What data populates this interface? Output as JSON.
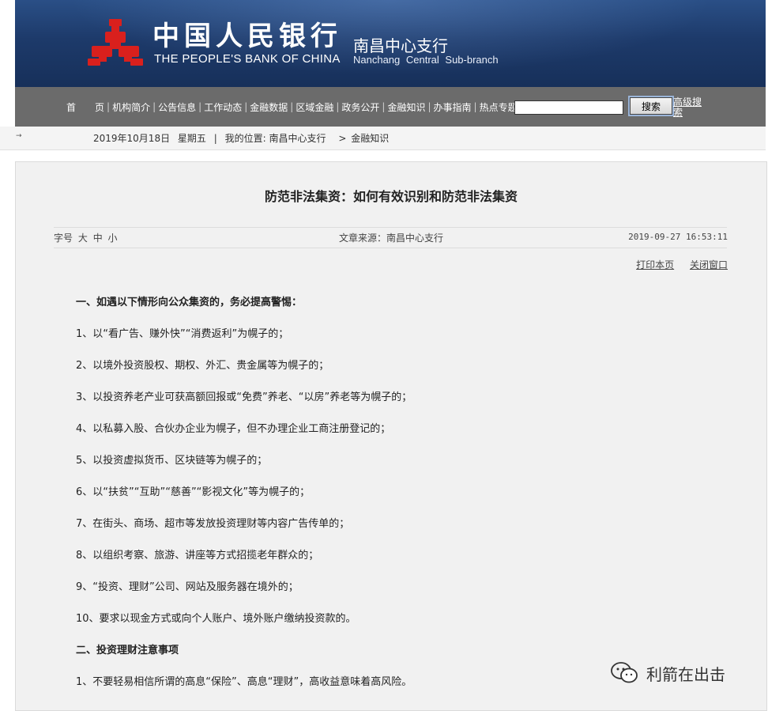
{
  "header": {
    "bank_name_cn": "中国人民银行",
    "bank_name_en": "THE PEOPLE'S BANK OF CHINA",
    "branch_cn": "南昌中心支行",
    "branch_en": "Nanchang Central Sub-branch",
    "logo_icon": "pboc-logo-icon",
    "logo_color": "#d9201d"
  },
  "nav": {
    "items": [
      "首　　页",
      "机构简介",
      "公告信息",
      "工作动态",
      "金融数据",
      "区域金融",
      "政务公开",
      "金融知识",
      "办事指南",
      "热点专题"
    ],
    "separator": "|",
    "search_value": "",
    "search_button": "搜索",
    "advanced_search": "高级搜索"
  },
  "breadcrumb": {
    "date": "2019年10月18日",
    "weekday": "星期五",
    "separator": "|",
    "location_label": "我的位置:",
    "location_root": "南昌中心支行",
    "arrow": ">",
    "current": "金融知识"
  },
  "article": {
    "title": "防范非法集资：如何有效识别和防范非法集资",
    "font_size_label": "字号",
    "font_sizes": [
      "大",
      "中",
      "小"
    ],
    "source": "文章来源：南昌中心支行",
    "datetime": "2019-09-27 16:53:11",
    "print": "打印本页",
    "close": "关闭窗口",
    "paragraphs": [
      {
        "text": "一、如遇以下情形向公众集资的，务必提高警惕：",
        "heading": true
      },
      {
        "text": "1、以“看广告、赚外快”“消费返利”为幌子的；",
        "heading": false
      },
      {
        "text": "2、以境外投资股权、期权、外汇、贵金属等为幌子的；",
        "heading": false
      },
      {
        "text": "3、以投资养老产业可获高额回报或“免费”养老、“以房”养老等为幌子的；",
        "heading": false
      },
      {
        "text": "4、以私募入股、合伙办企业为幌子，但不办理企业工商注册登记的；",
        "heading": false
      },
      {
        "text": "5、以投资虚拟货币、区块链等为幌子的；",
        "heading": false
      },
      {
        "text": "6、以“扶贫”“互助”“慈善”“影视文化”等为幌子的；",
        "heading": false
      },
      {
        "text": "7、在街头、商场、超市等发放投资理财等内容广告传单的；",
        "heading": false
      },
      {
        "text": "8、以组织考察、旅游、讲座等方式招揽老年群众的；",
        "heading": false
      },
      {
        "text": "9、“投资、理财”公司、网站及服务器在境外的；",
        "heading": false
      },
      {
        "text": "10、要求以现金方式或向个人账户、境外账户缴纳投资款的。",
        "heading": false
      },
      {
        "text": "二、投资理财注意事项",
        "heading": true
      },
      {
        "text": "1、不要轻易相信所谓的高息“保险”、高息“理财”，高收益意味着高风险。",
        "heading": false
      }
    ]
  },
  "watermark": {
    "icon": "wechat-icon",
    "text": "利箭在出击"
  }
}
